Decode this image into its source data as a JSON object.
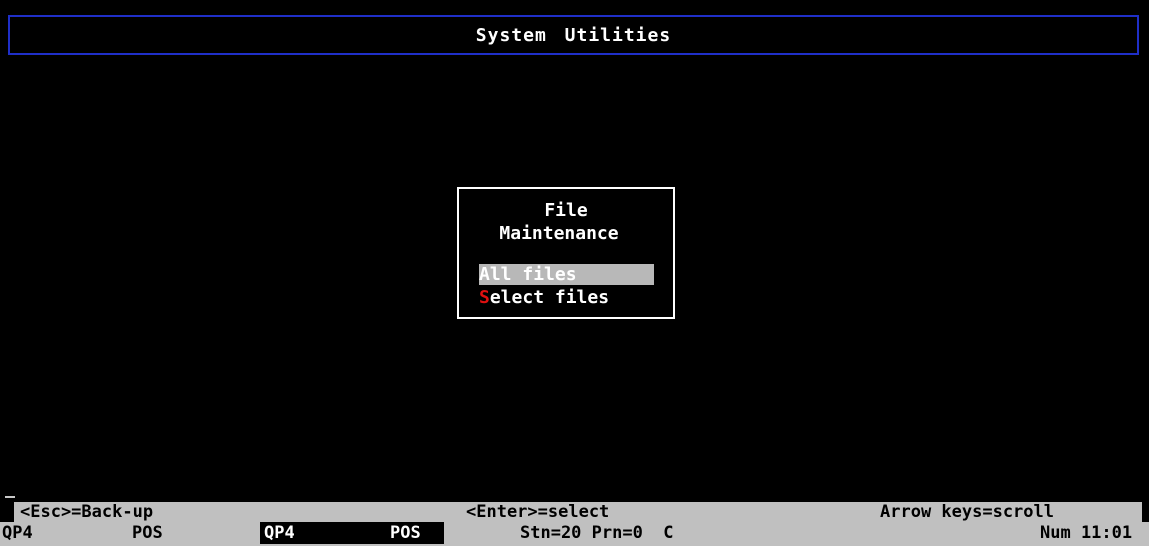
{
  "window": {
    "title": "System  Utilities"
  },
  "dialog": {
    "title_line1": "File",
    "title_line2": "Maintenance",
    "options": [
      {
        "hotkey": "A",
        "rest": "ll files",
        "selected": true
      },
      {
        "hotkey": "S",
        "rest": "elect files",
        "selected": false
      }
    ]
  },
  "help_bar": {
    "esc": "<Esc>=Back-up",
    "enter": "<Enter>=select",
    "arrows": "Arrow keys=scroll"
  },
  "status_bar": {
    "qp4_1": "QP4",
    "pos_1": "POS",
    "qp4_2": "QP4",
    "pos_2": "POS",
    "station": "Stn=20 Prn=0  C",
    "num_time": "Num 11:01"
  },
  "colors": {
    "title_border": "#1f2fc8",
    "background": "#000000",
    "bar_gray": "#c0c0c0",
    "selection_gray": "#b8b8b8",
    "hotkey_red": "#e01010"
  }
}
